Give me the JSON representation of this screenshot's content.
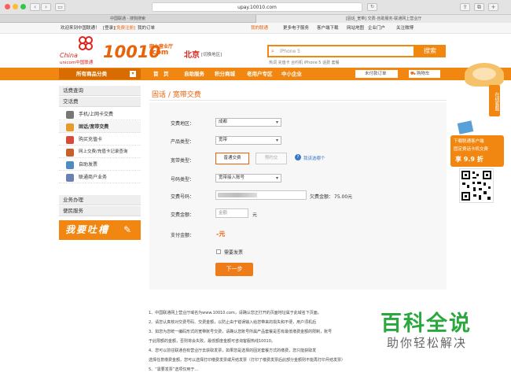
{
  "browser": {
    "url": "upay.10010.com",
    "tab1": "中国联通 - 搜狗搜索",
    "tab2": "[固话_宽带] 交费-自助服务-联通网上营业厅"
  },
  "topbar": {
    "welcome": "欢迎来到中国联通！",
    "login": "[登录]",
    "register": "[免费注册]",
    "orders": "我的订单",
    "myunicom": "我的联通",
    "more_products": "更多电子服务",
    "client_download": "客户端下载",
    "sitemap": "网站地图",
    "enterprise": "企业门户",
    "weibo": "关注微博"
  },
  "header": {
    "logo_cn": "China",
    "logo_unicom": "unicom中国联通",
    "hotline": "10010",
    "hotline_sub": "网上营业厅",
    "hotline_com": ".com",
    "city": "北京",
    "city_switch": "[切换地区]",
    "search_placeholder": "iPhone 5",
    "search_button": "搜索",
    "hot_words": "热词  充值卡  合约机  iPhone 5 话费  套餐"
  },
  "nav": {
    "categories": "所有商品分类",
    "home": "首　页",
    "self_service": "自助服务",
    "points_mall": "积分商城",
    "senior": "老用户专区",
    "sme": "中小企业",
    "unpaid": "未付款订单",
    "cart": "购物车"
  },
  "sidebar": {
    "head1": "话费查询",
    "head2": "交话费",
    "items": [
      {
        "label": "手机/上网卡交费"
      },
      {
        "label": "固话/宽带交费"
      },
      {
        "label": "购买充值卡"
      },
      {
        "label": "网上交费/充值卡记录查询"
      },
      {
        "label": "自助发票"
      },
      {
        "label": "联通商户业务"
      }
    ],
    "head3": "业务办理",
    "head4": "便民服务",
    "complaint": "我要吐槽"
  },
  "form": {
    "title": "固话 / 宽带交费",
    "area_label": "交费地区：",
    "area_value": "成都",
    "product_label": "产品类型：",
    "product_value": "宽带",
    "kind_label": "宽带类型：",
    "kind_normal": "普通交费",
    "kind_prepay": "预约交",
    "help": "我该选哪个",
    "numtype_label": "号码类型：",
    "numtype_value": "宽带接入账号",
    "number_label": "交费号码：",
    "owed_label": "欠费金额：",
    "owed_value": "75.00元",
    "amount_label": "交费金额：",
    "amount_placeholder": "金额",
    "amount_unit": "元",
    "payment_label": "支付金额：",
    "payment_value": "-元",
    "invoice": "需要发票",
    "next": "下一步"
  },
  "notes": [
    "1、中国联通网上营业厅域名为www.10010.com，请确认您正打开的页面地址属于此域名下页面。",
    "2、请您认真核对交费号码、交费金额，以防止由于错误输入给您带来的损失和不便，用户须机后",
    "3、如您为您统一编码形式的宽带账号交费，请确认您账号所属产品套餐是否有最低缴费金额的限制，账号",
    "于此限额的金额，否则将会失败。最低额度金额可咨询客服热线10010。",
    "4、您可以前往联通自有营业厅去获取发票，如果您是选择的固定套餐方式的缴费，您只能获取发",
    "选择任意缴费金额。您可以选择打印缴费发票或月结发票（打印了缴费发票后此部分金额则不能再打印月结发票）",
    "5、“需要发票”选项仅用于..."
  ],
  "rightbar": {
    "online_service": "在线客服",
    "download": "下载联通客户端",
    "promo": "固定费话卡机交费",
    "discount": "享 9.9 折"
  },
  "watermark": {
    "big": "百科全说",
    "small": "助你轻松解决"
  },
  "colors": {
    "brand_orange": "#f18610",
    "button_orange": "#ee7d19",
    "watermark_green": "#2aa83e"
  }
}
